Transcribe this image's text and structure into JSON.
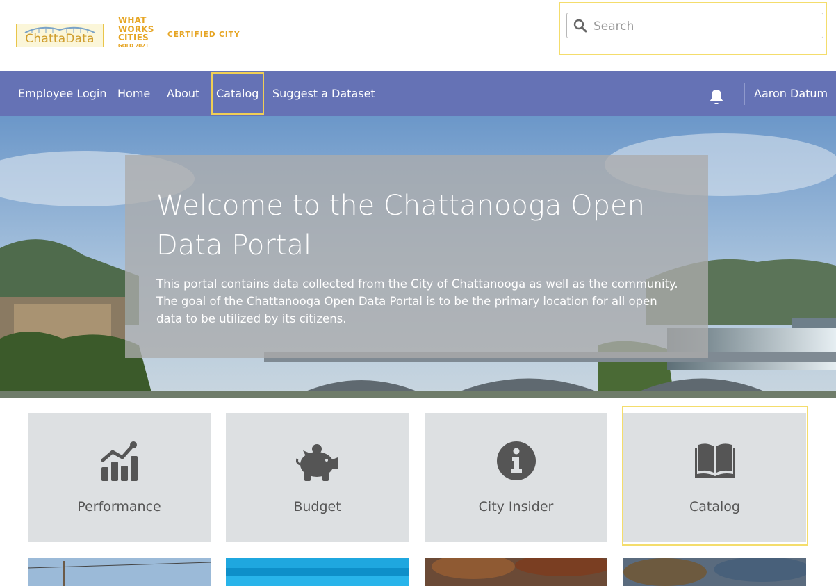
{
  "header": {
    "logo_text": "ChattaData",
    "wwc_lines": [
      "WHAT",
      "WORKS",
      "CITIES"
    ],
    "wwc_gold": "GOLD 2021",
    "wwc_certified": "CERTIFIED CITY",
    "search_placeholder": "Search"
  },
  "nav": {
    "items": [
      {
        "label": "Employee Login"
      },
      {
        "label": "Home"
      },
      {
        "label": "About"
      },
      {
        "label": "Catalog"
      },
      {
        "label": "Suggest a Dataset"
      }
    ],
    "notifications_icon": "bell-icon",
    "user_name": "Aaron Datum"
  },
  "hero": {
    "title": "Welcome to the Chattanooga Open Data Portal",
    "description": "This portal contains data collected from the City of Chattanooga as well as the community. The goal of the Chattanooga Open Data Portal is to be the primary location for all open data to be utilized by its citizens."
  },
  "tiles": [
    {
      "label": "Performance",
      "icon": "chart-icon"
    },
    {
      "label": "Budget",
      "icon": "piggy-bank-icon"
    },
    {
      "label": "City Insider",
      "icon": "info-icon"
    },
    {
      "label": "Catalog",
      "icon": "book-icon"
    }
  ],
  "colors": {
    "nav_bg": "#6572b5",
    "tile_bg": "#dde0e2",
    "icon": "#555555",
    "highlight": "#f4dd6c",
    "brand_gold": "#e6a524"
  }
}
